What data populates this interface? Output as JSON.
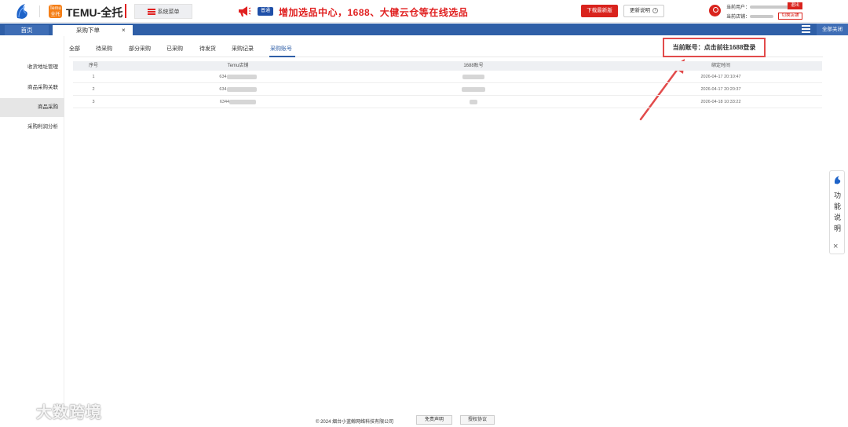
{
  "topbar": {
    "app_name": "TEMU-全托",
    "badge_text": "Temu全托",
    "system_menu": "系统菜单",
    "announce_tag": "普通",
    "announcement": "增加选品中心，1688、大健云仓等在线选品",
    "download_btn": "下载最新版",
    "update_btn": "更新说明",
    "current_user_label": "当前用户：",
    "current_shop_label": "当前店铺：",
    "logout_btn": "退出",
    "switch_shop_btn": "切换店铺"
  },
  "tabs": {
    "home": "首页",
    "active": "采购下单",
    "close_all": "全部关闭"
  },
  "sidebar": {
    "items": [
      {
        "label": "收货地址管理"
      },
      {
        "label": "商品采购关联"
      },
      {
        "label": "商品采购"
      },
      {
        "label": "采购利润分析"
      }
    ]
  },
  "subtabs": [
    "全部",
    "待采购",
    "部分采购",
    "已采购",
    "待发货",
    "采购记录",
    "采购账号"
  ],
  "account": {
    "label": "当前账号：",
    "link": "点击前往1688登录"
  },
  "table": {
    "headers": [
      "序号",
      "Temu店铺",
      "1688账号",
      "绑定时间"
    ],
    "rows": [
      {
        "index": "1",
        "shop": "634",
        "time": "2026-04-17 20:10:47"
      },
      {
        "index": "2",
        "shop": "634",
        "time": "2026-04-17 20:20:37"
      },
      {
        "index": "3",
        "shop": "6344",
        "time": "2026-04-18 10:33:22"
      }
    ]
  },
  "float_panel": {
    "text": "功能说明"
  },
  "footer": {
    "copyright": "© 2024 烟台小蓝鲸网络科技有限公司",
    "disclaimer": "免责声明",
    "license": "授权协议"
  },
  "watermark": "大数跨境",
  "colors": {
    "brand_blue": "#2f5fa7",
    "accent_red": "#d9231d",
    "temu_orange": "#f57f17"
  }
}
